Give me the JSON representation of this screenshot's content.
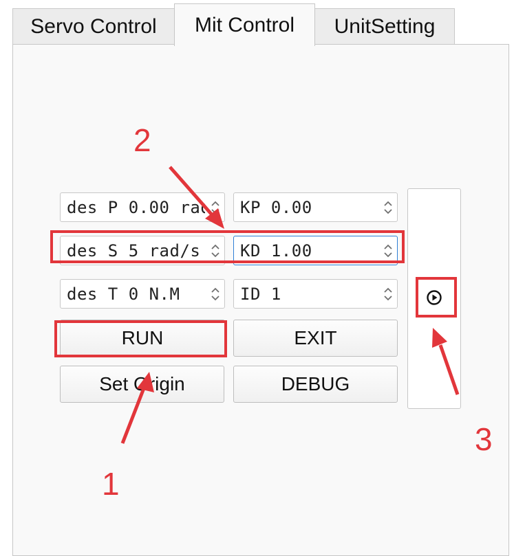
{
  "tabs": [
    {
      "label": "Servo Control",
      "active": false
    },
    {
      "label": "Mit Control",
      "active": true
    },
    {
      "label": "UnitSetting",
      "active": false
    }
  ],
  "spinboxes": {
    "des_p": "des P 0.00 rad",
    "des_s": "des S 5 rad/s",
    "des_t": "des T 0 N.M",
    "kp": "KP 0.00",
    "kd": "KD 1.00",
    "id": "ID 1"
  },
  "buttons": {
    "run": "RUN",
    "exit": "EXIT",
    "set_origin": "Set Origin",
    "debug": "DEBUG"
  },
  "annotations": {
    "one": "1",
    "two": "2",
    "three": "3"
  },
  "icons": {
    "play": "play-circle-icon",
    "spin_arrows": "updown-arrows-icon"
  },
  "colors": {
    "annotation_red": "#e2363b",
    "focus_blue": "#2f7fd6"
  }
}
